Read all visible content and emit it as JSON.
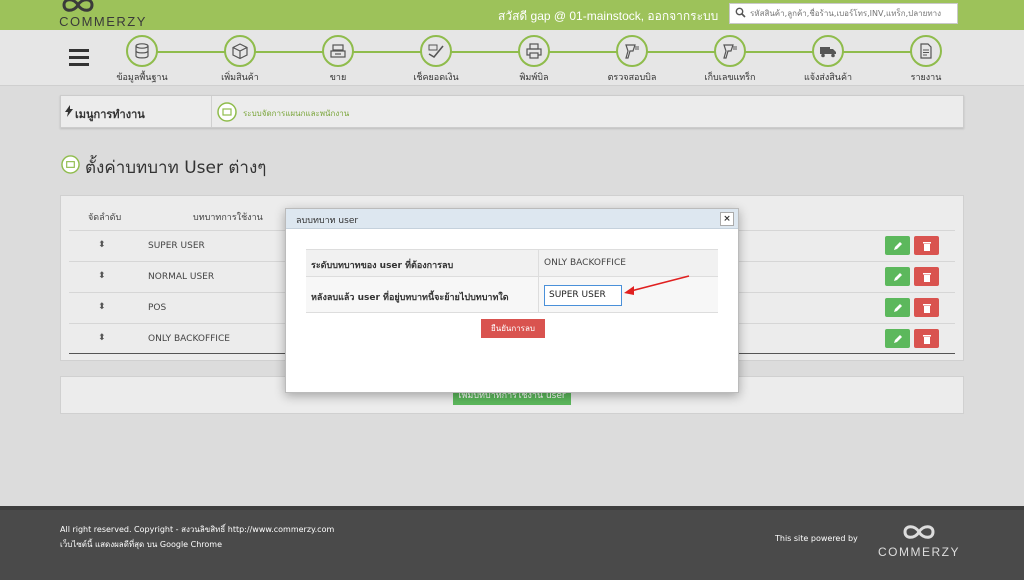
{
  "header": {
    "logo": "COMMERZY",
    "greeting": "สวัสดี gap @ 01-mainstock,  ออกจากระบบ",
    "search_placeholder": "รหัสสินค้า,ลูกค้า,ชื่อร้าน,เบอร์โทร,INV,แทร็ก,ปลายทาง"
  },
  "nav": {
    "steps": [
      {
        "label": "ข้อมูลพื้นฐาน",
        "icon": "database-icon"
      },
      {
        "label": "เพิ่มสินค้า",
        "icon": "box-icon"
      },
      {
        "label": "ขาย",
        "icon": "cash-register-icon"
      },
      {
        "label": "เช็คยอดเงิน",
        "icon": "money-check-icon"
      },
      {
        "label": "พิมพ์บิล",
        "icon": "printer-icon"
      },
      {
        "label": "ตรวจสอบบิล",
        "icon": "barcode-scanner-icon"
      },
      {
        "label": "เก็บเลขแทร็ก",
        "icon": "barcode-scanner-icon"
      },
      {
        "label": "แจ้งส่งสินค้า",
        "icon": "truck-icon"
      },
      {
        "label": "รายงาน",
        "icon": "report-icon"
      }
    ]
  },
  "menu": {
    "title": "เมนูการทำงาน",
    "link": "ระบบจัดการแผนกและพนักงาน"
  },
  "page": {
    "title": "ตั้งค่าบทบาท User ต่างๆ"
  },
  "table": {
    "headers": [
      "จัดลำดับ",
      "บทบาทการใช้งาน"
    ],
    "rows": [
      {
        "name": "SUPER USER"
      },
      {
        "name": "NORMAL USER"
      },
      {
        "name": "POS"
      },
      {
        "name": "ONLY BACKOFFICE"
      }
    ],
    "add_button": "เพิ่มบทบาทการใช้งาน user"
  },
  "modal": {
    "title": "ลบบทบาท user",
    "close": "×",
    "row1_label": "ระดับบทบาทของ user ที่ต้องการลบ",
    "row1_value": "ONLY BACKOFFICE",
    "row2_label": "หลังลบแล้ว user ที่อยู่บทบาทนี้จะย้ายไปบทบาทใด",
    "row2_value": "SUPER USER",
    "confirm": "ยืนยันการลบ"
  },
  "footer": {
    "line1": "All right reserved. Copyright - สงวนลิขสิทธิ์ http://www.commerzy.com",
    "line2": "เว็บไซต์นี้ แสดงผลดีที่สุด บน Google Chrome",
    "powered": "This site powered by",
    "logo": "COMMERZY"
  },
  "colors": {
    "brand_green": "#9dc25a",
    "accent_green": "#5cb85c",
    "danger_red": "#d9534f",
    "footer_bg": "#4a4a4a"
  }
}
